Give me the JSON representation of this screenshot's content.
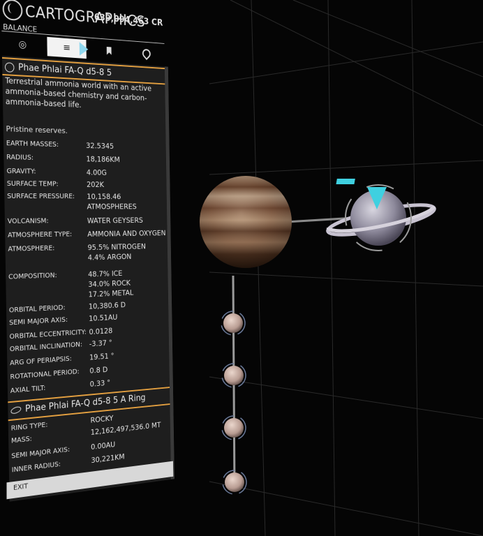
{
  "header": {
    "app_title": "CARTOGRAPHICS",
    "credits": "639,094,463 CR",
    "balance_label": "BALANCE"
  },
  "tabs": [
    {
      "icon": "target-icon",
      "glyph": "◎"
    },
    {
      "icon": "list-icon",
      "glyph": "≡"
    },
    {
      "icon": "bookmark-icon",
      "glyph": "🔖"
    },
    {
      "icon": "map-pin-icon",
      "glyph": "⌖"
    }
  ],
  "body": {
    "name": "Phae Phlai FA-Q d5-8 5",
    "description": "Terrestrial ammonia world with an active ammonia-based chemistry and carbon-ammonia-based life.",
    "reserves": "Pristine reserves.",
    "properties": [
      {
        "label": "EARTH MASSES:",
        "value": "32.5345"
      },
      {
        "label": "RADIUS:",
        "value": "18,186KM"
      },
      {
        "label": "GRAVITY:",
        "value": "4.00G"
      },
      {
        "label": "SURFACE TEMP:",
        "value": "202K"
      },
      {
        "label": "SURFACE PRESSURE:",
        "value": "10,158.46\nATMOSPHERES"
      },
      {
        "label": "VOLCANISM:",
        "value": "WATER GEYSERS"
      },
      {
        "label": "ATMOSPHERE TYPE:",
        "value": "AMMONIA AND OXYGEN"
      },
      {
        "label": "ATMOSPHERE:",
        "value": "95.5% NITROGEN\n4.4% ARGON"
      },
      {
        "label": "COMPOSITION:",
        "value": "48.7% ICE\n34.0% ROCK\n17.2% METAL"
      },
      {
        "label": "ORBITAL PERIOD:",
        "value": "10,380.6 D"
      },
      {
        "label": "SEMI MAJOR AXIS:",
        "value": "10.51AU"
      },
      {
        "label": "ORBITAL ECCENTRICITY:",
        "value": "0.0128"
      },
      {
        "label": "ORBITAL INCLINATION:",
        "value": "-3.37 °"
      },
      {
        "label": "ARG OF PERIAPSIS:",
        "value": "19.51 °"
      },
      {
        "label": "ROTATIONAL PERIOD:",
        "value": "0.8 D"
      },
      {
        "label": "AXIAL TILT:",
        "value": "0.33 °"
      }
    ]
  },
  "ring": {
    "name": "Phae Phlai FA-Q d5-8 5 A Ring",
    "properties": [
      {
        "label": "RING TYPE:",
        "value": "ROCKY"
      },
      {
        "label": "MASS:",
        "value": "12,162,497,536.0 MT"
      },
      {
        "label": "SEMI MAJOR AXIS:",
        "value": "0.00AU"
      },
      {
        "label": "INNER RADIUS:",
        "value": "30,221KM"
      }
    ]
  },
  "footer": {
    "exit_label": "EXIT"
  },
  "colors": {
    "accent": "#e4a040",
    "selection": "#3fd0e0"
  }
}
